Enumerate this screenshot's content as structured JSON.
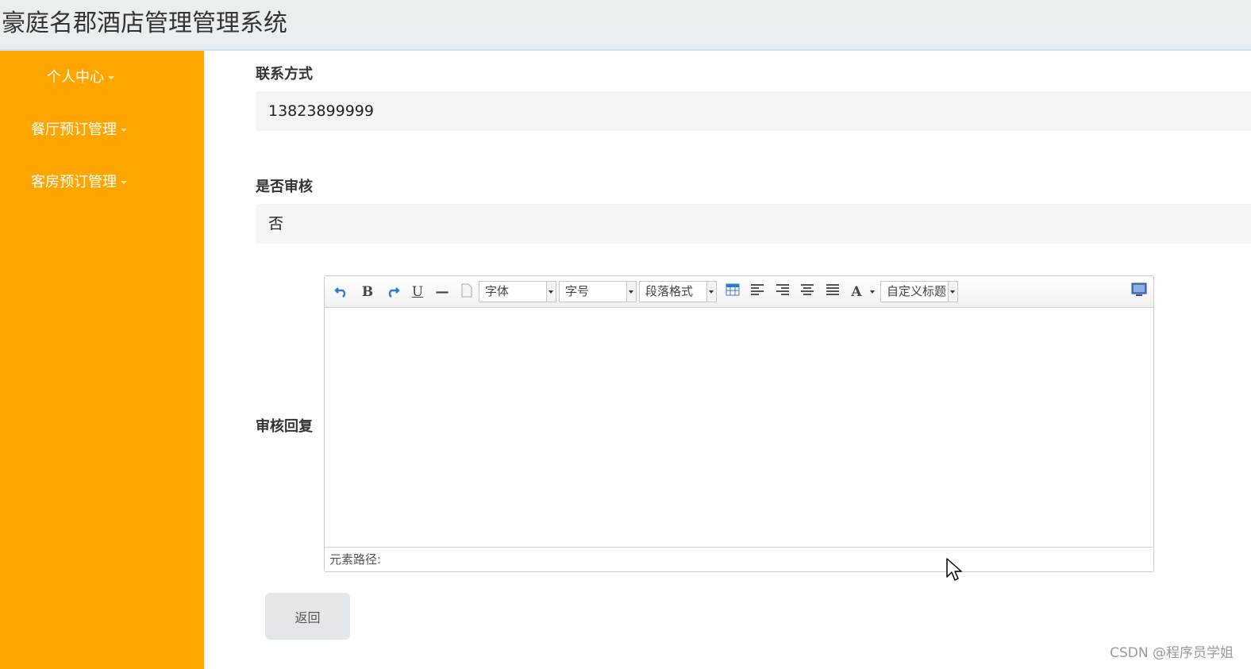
{
  "app": {
    "title": "豪庭名郡酒店管理管理系统"
  },
  "sidebar": {
    "items": [
      {
        "label": "个人中心"
      },
      {
        "label": "餐厅预订管理"
      },
      {
        "label": "客房预订管理"
      }
    ]
  },
  "form": {
    "contact": {
      "label": "联系方式",
      "value": "13823899999"
    },
    "audit": {
      "label": "是否审核",
      "value": "否"
    },
    "reply": {
      "label": "审核回复"
    }
  },
  "editor": {
    "toolbar": {
      "undo_icon": "undo-icon",
      "bold_label": "B",
      "redo_icon": "redo-icon",
      "underline_label": "U",
      "hr_label": "—",
      "font_family": "字体",
      "font_size": "字号",
      "paragraph": "段落格式",
      "text_color_label": "A",
      "custom_title": "自定义标题"
    },
    "status_label": "元素路径:"
  },
  "actions": {
    "back_label": "返回"
  },
  "watermark": "CSDN @程序员学姐",
  "colors": {
    "sidebar": "#ffa500",
    "topbar": "#e9eef1",
    "field_bg": "#f3f5f6",
    "button_bg": "#e4e7ea"
  }
}
